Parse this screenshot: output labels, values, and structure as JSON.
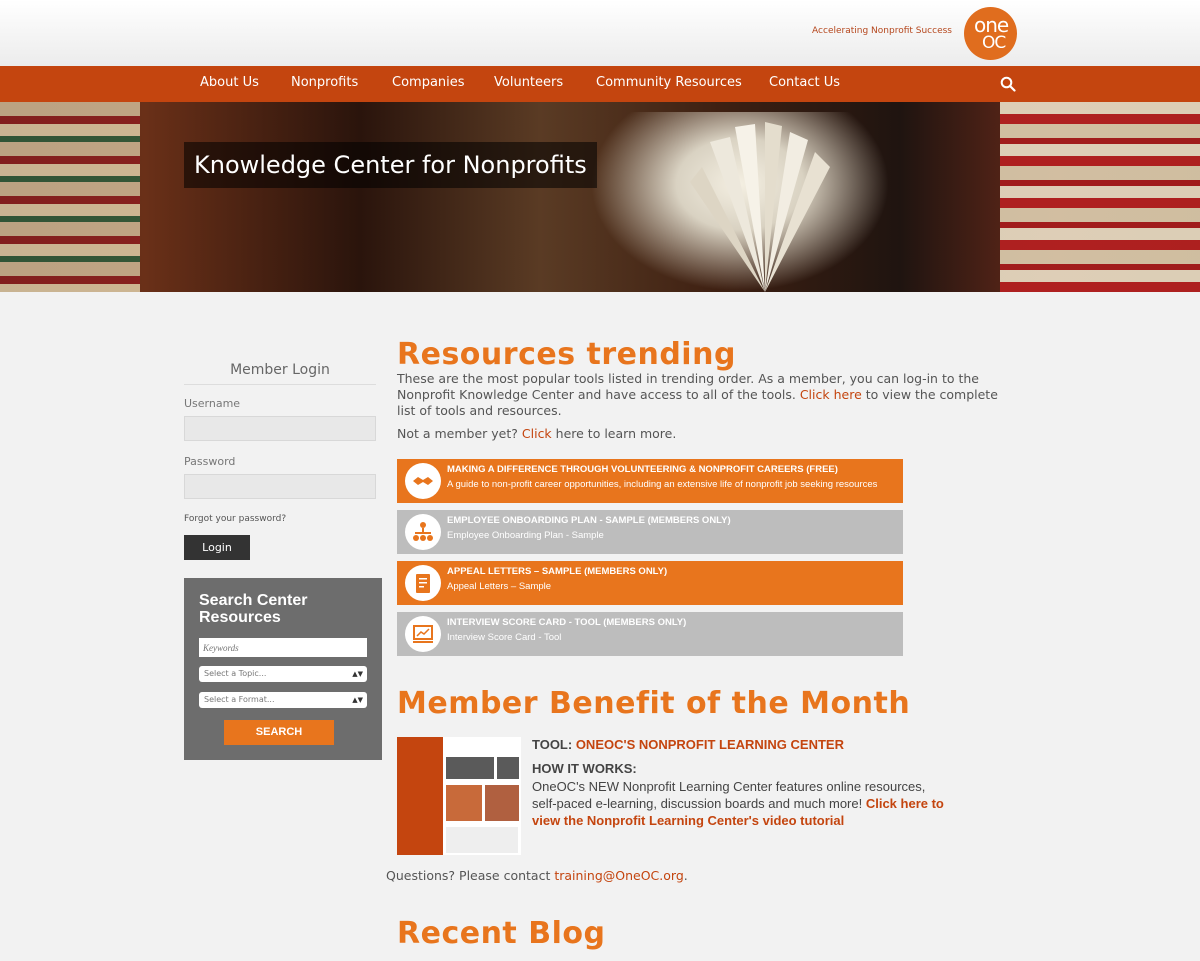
{
  "header": {
    "tagline": "Accelerating Nonprofit Success",
    "logo_top": "one",
    "logo_bottom": "OC"
  },
  "nav": {
    "items": [
      "About Us",
      "Nonprofits",
      "Companies",
      "Volunteers",
      "Community Resources",
      "Contact Us"
    ]
  },
  "hero": {
    "title": "Knowledge Center for Nonprofits"
  },
  "login": {
    "heading": "Member Login",
    "username_label": "Username",
    "password_label": "Password",
    "forgot": "Forgot your password?",
    "button": "Login"
  },
  "search_center": {
    "title": "Search Center Resources",
    "keywords_placeholder": "Keywords",
    "topic_select": "Select a Topic...",
    "format_select": "Select a Format...",
    "button": "SEARCH"
  },
  "trending": {
    "heading": "Resources trending",
    "intro_1": "These are the most popular tools listed in trending order. As a member, you can log-in to the Nonprofit Knowledge Center and have access to all of the tools. ",
    "intro_link": "Click here",
    "intro_2": " to view the complete list of tools and resources.",
    "not_member_1": "Not a member yet?  ",
    "not_member_link": "Click",
    "not_member_2": " here to learn more.",
    "items": [
      {
        "title": "MAKING A DIFFERENCE THROUGH VOLUNTEERING & NONPROFIT CAREERS (FREE)",
        "subtitle": "A guide to non-profit career opportunities, including an extensive life of nonprofit job seeking resources",
        "icon": "handshake-icon",
        "color": "#e8751d"
      },
      {
        "title": "EMPLOYEE ONBOARDING PLAN - SAMPLE (MEMBERS ONLY)",
        "subtitle": "Employee Onboarding Plan - Sample",
        "icon": "org-chart-icon",
        "color": "#bdbdbd"
      },
      {
        "title": "APPEAL LETTERS – SAMPLE (MEMBERS ONLY)",
        "subtitle": "Appeal Letters – Sample",
        "icon": "clipboard-icon",
        "color": "#e8751d"
      },
      {
        "title": "INTERVIEW SCORE CARD - TOOL (MEMBERS ONLY)",
        "subtitle": "Interview Score Card - Tool",
        "icon": "presentation-icon",
        "color": "#bdbdbd"
      }
    ]
  },
  "member_benefit": {
    "heading": "Member Benefit of the Month",
    "tool_label": "TOOL: ",
    "tool_name": "ONEOC'S NONPROFIT LEARNING CENTER",
    "how_label": "HOW IT WORKS:",
    "desc": "OneOC's NEW Nonprofit Learning Center features online resources, self-paced e-learning, discussion boards and much more! ",
    "desc_link": "Click here to view the Nonprofit Learning Center's video tutorial",
    "questions": "Questions? Please contact ",
    "email": "training@OneOC.org",
    "questions_end": "."
  },
  "blog": {
    "heading": "Recent Blog"
  },
  "colors": {
    "brand_orange": "#e8751d",
    "nav_rust": "#c4450f",
    "card_grey": "#bdbdbd"
  }
}
